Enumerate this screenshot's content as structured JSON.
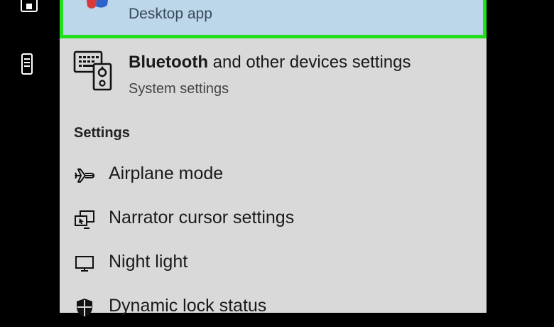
{
  "best_match": {
    "subtitle": "Desktop app"
  },
  "result": {
    "title_bold": "Bluetooth",
    "title_rest": " and other devices settings",
    "subtitle": "System settings"
  },
  "settings_section": {
    "heading": "Settings",
    "items": [
      {
        "label": "Airplane mode",
        "icon": "airplane-icon"
      },
      {
        "label": "Narrator cursor settings",
        "icon": "narrator-icon"
      },
      {
        "label": "Night light",
        "icon": "monitor-icon"
      },
      {
        "label": "Dynamic lock status",
        "icon": "shield-icon"
      }
    ]
  },
  "colors": {
    "highlight_bg": "#bcd6ea",
    "highlight_border": "#22e01c",
    "panel_bg": "#d9d9d9"
  }
}
